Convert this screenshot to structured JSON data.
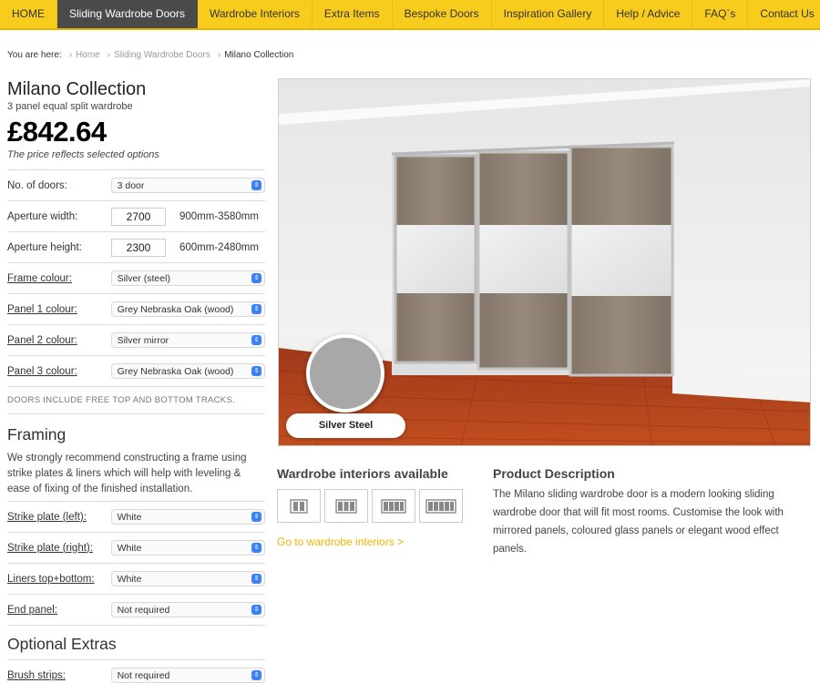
{
  "nav": {
    "items": [
      {
        "label": "HOME",
        "active": false
      },
      {
        "label": "Sliding Wardrobe Doors",
        "active": true
      },
      {
        "label": "Wardrobe Interiors",
        "active": false
      },
      {
        "label": "Extra Items",
        "active": false
      },
      {
        "label": "Bespoke Doors",
        "active": false
      },
      {
        "label": "Inspiration Gallery",
        "active": false
      },
      {
        "label": "Help / Advice",
        "active": false
      },
      {
        "label": "FAQ`s",
        "active": false
      },
      {
        "label": "Contact Us",
        "active": false
      }
    ]
  },
  "breadcrumb": {
    "prefix": "You are here:",
    "items": [
      "Home",
      "Sliding Wardrobe Doors",
      "Milano Collection"
    ]
  },
  "product": {
    "title": "Milano Collection",
    "subtitle": "3 panel equal split wardrobe",
    "price": "£842.64",
    "price_note": "The price reflects selected options"
  },
  "options": {
    "doors": {
      "label": "No. of doors:",
      "value": "3 door"
    },
    "width": {
      "label": "Aperture width:",
      "value": "2700",
      "range": "900mm-3580mm"
    },
    "height": {
      "label": "Aperture height:",
      "value": "2300",
      "range": "600mm-2480mm"
    },
    "frame": {
      "label": "Frame colour:",
      "value": "Silver (steel)"
    },
    "panel1": {
      "label": "Panel 1 colour:",
      "value": "Grey Nebraska Oak (wood)"
    },
    "panel2": {
      "label": "Panel 2 colour:",
      "value": "Silver mirror"
    },
    "panel3": {
      "label": "Panel 3 colour:",
      "value": "Grey Nebraska Oak (wood)"
    }
  },
  "notice": "DOORS INCLUDE FREE TOP AND BOTTOM TRACKS.",
  "framing": {
    "heading": "Framing",
    "text": "We strongly recommend constructing a frame using strike plates & liners which will help with leveling & ease of fixing of the finished installation.",
    "strike_left": {
      "label": "Strike plate (left):",
      "value": "White"
    },
    "strike_right": {
      "label": "Strike plate (right):",
      "value": "White"
    },
    "liners": {
      "label": "Liners top+bottom:",
      "value": "White"
    },
    "end_panel": {
      "label": "End panel:",
      "value": "Not required"
    }
  },
  "extras": {
    "heading": "Optional Extras",
    "brush": {
      "label": "Brush strips:",
      "value": "Not required"
    }
  },
  "hero": {
    "badge_label": "Silver Steel",
    "colors": {
      "swatch": "#a8a8a8",
      "floor": "#b4401a",
      "wood": "#8a7d72"
    }
  },
  "interiors": {
    "title": "Wardrobe interiors available",
    "thumbs": [
      "2-section-icon",
      "3-section-icon",
      "4-section-icon",
      "5-section-icon"
    ],
    "link": "Go to wardrobe interiors >"
  },
  "description": {
    "title": "Product Description",
    "text": "The Milano sliding wardrobe door is a modern looking sliding wardrobe door that will fit most rooms. Customise the look with mirrored panels, coloured glass panels or elegant wood effect panels."
  },
  "theme": {
    "accent": "#f7cc1c",
    "nav_active": "#4a4a4a",
    "link": "#f5b400"
  }
}
